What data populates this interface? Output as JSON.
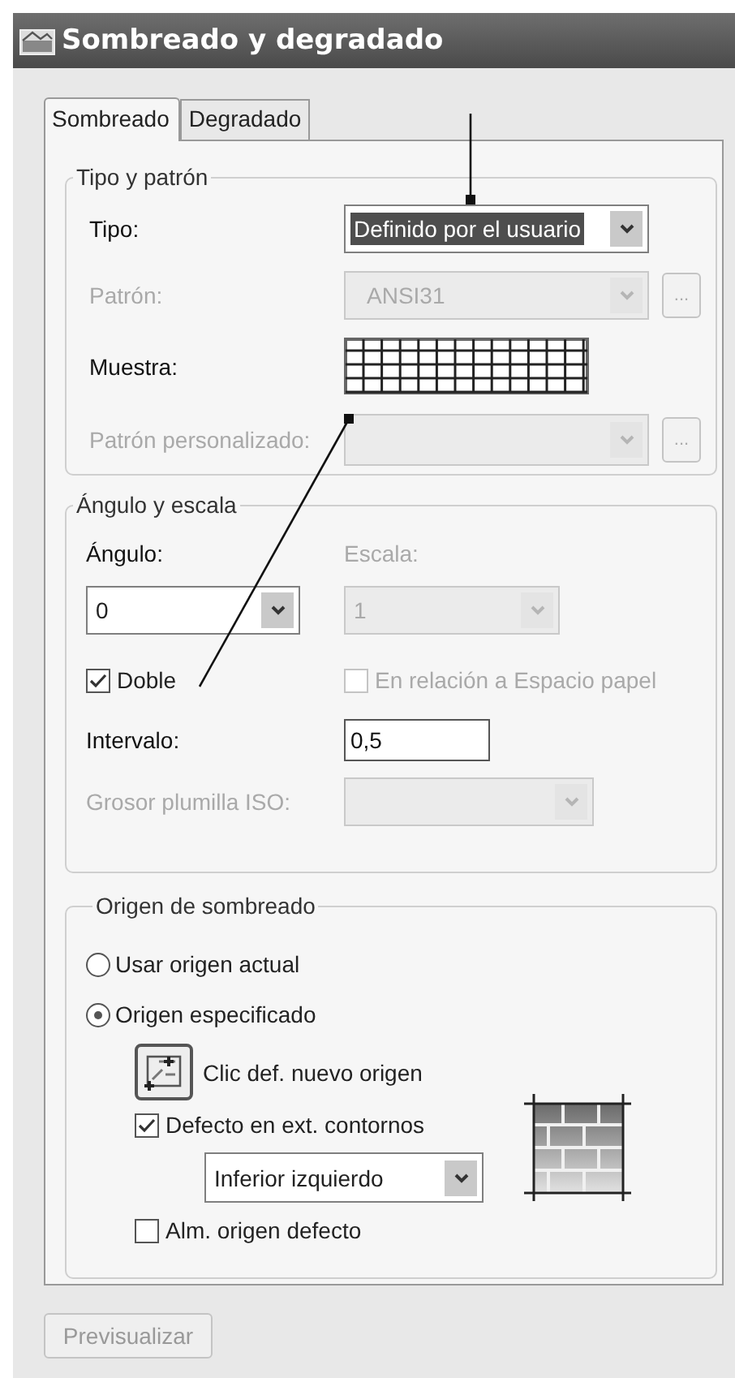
{
  "window": {
    "title": "Sombreado y degradado"
  },
  "tabs": [
    {
      "label": "Sombreado",
      "selected": true
    },
    {
      "label": "Degradado",
      "selected": false
    }
  ],
  "pattern_group": {
    "title": "Tipo y patrón",
    "type": {
      "label": "Tipo:",
      "value": "Definido por el usuario",
      "disabled": false,
      "focused": true
    },
    "pattern": {
      "label": "Patrón:",
      "value": "ANSI31",
      "disabled": true,
      "browse_label": "..."
    },
    "sample": {
      "label": "Muestra:"
    },
    "custom_pattern": {
      "label": "Patrón personalizado:",
      "disabled": true,
      "browse_label": "..."
    }
  },
  "angle_group": {
    "title": "Ángulo y escala",
    "angle": {
      "label": "Ángulo:",
      "value": "0",
      "disabled": false
    },
    "scale": {
      "label": "Escala:",
      "value": "1",
      "disabled": true
    },
    "double": {
      "label": "Doble",
      "checked": true,
      "disabled": false
    },
    "paper_space": {
      "label": "En relación a Espacio papel",
      "checked": false,
      "disabled": true
    },
    "spacing": {
      "label": "Intervalo:",
      "value": "0,5"
    },
    "iso_pen": {
      "label": "Grosor plumilla ISO:",
      "disabled": true
    }
  },
  "origin_group": {
    "title": "Origen de sombreado",
    "options": [
      {
        "label": "Usar origen actual",
        "selected": false
      },
      {
        "label": "Origen especificado",
        "selected": true
      }
    ],
    "pick_button": {
      "label": "Clic def. nuevo origen"
    },
    "default_extents": {
      "label": "Defecto en ext. contornos",
      "checked": true,
      "disabled": false
    },
    "position": {
      "value": "Inferior izquierdo",
      "disabled": false
    },
    "store_default": {
      "label": "Alm. origen defecto",
      "checked": false,
      "disabled": false
    }
  },
  "preview_button": {
    "label": "Previsualizar",
    "disabled": true
  }
}
